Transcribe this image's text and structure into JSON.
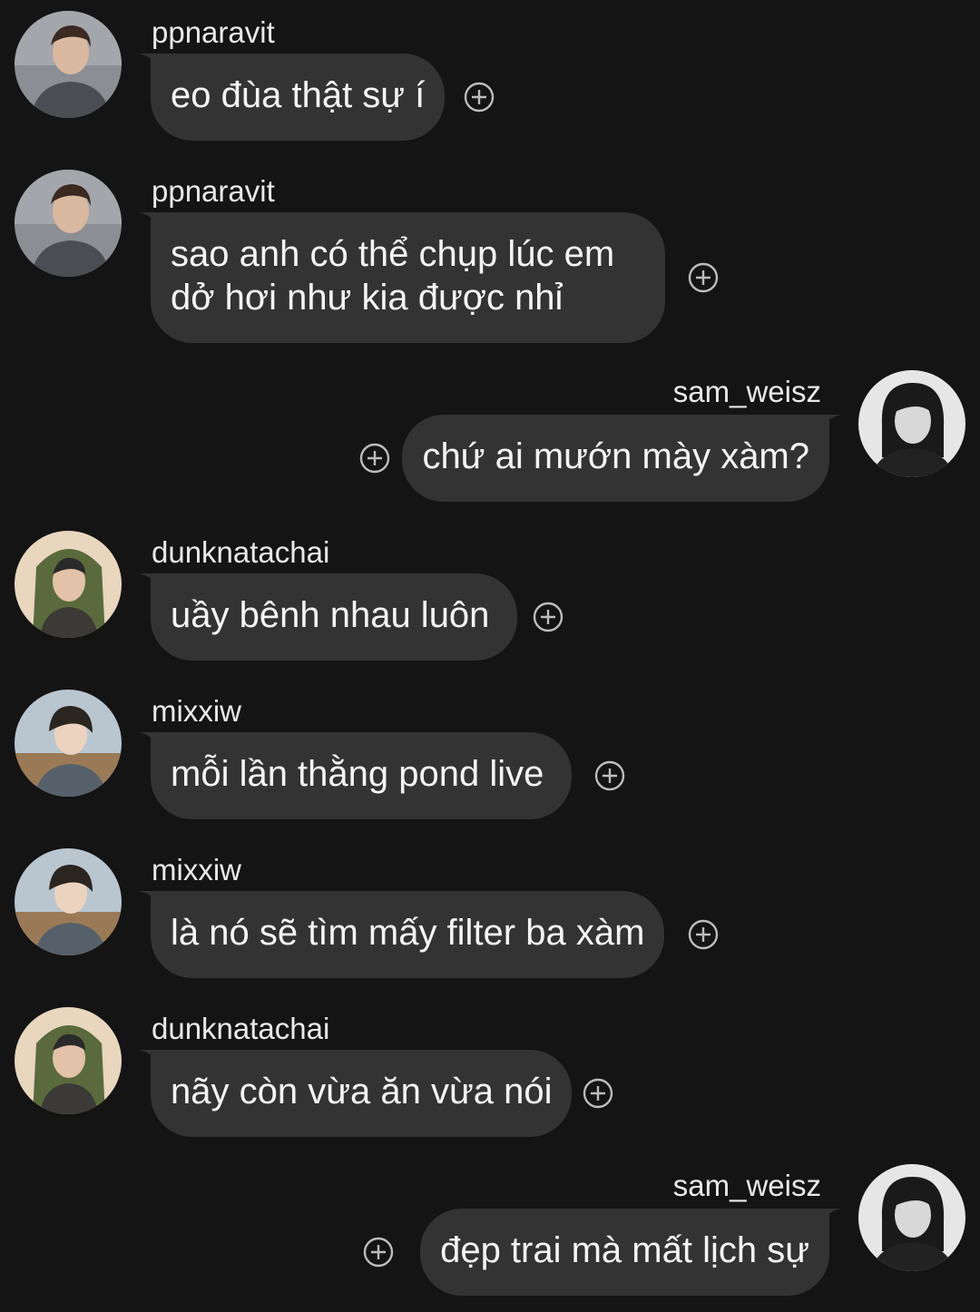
{
  "theme": {
    "background": "#141414",
    "bubble": "#333333",
    "text": "#f4f4f4"
  },
  "messages": [
    {
      "side": "incoming",
      "username": "ppnaravit",
      "text": "eo đùa thật sự í",
      "avatar": "user-avatar-icon",
      "react_icon": "add-reaction-icon"
    },
    {
      "side": "incoming",
      "username": "ppnaravit",
      "text": "sao anh có thể chụp lúc em\ndở hơi như kia được nhỉ",
      "avatar": "user-avatar-icon",
      "react_icon": "add-reaction-icon"
    },
    {
      "side": "outgoing",
      "username": "sam_weisz",
      "text": "chứ ai mướn mày xàm?",
      "avatar": "user-avatar-icon",
      "react_icon": "add-reaction-icon"
    },
    {
      "side": "incoming",
      "username": "dunknatachai",
      "text": "uầy bênh nhau luôn",
      "avatar": "user-avatar-icon",
      "react_icon": "add-reaction-icon"
    },
    {
      "side": "incoming",
      "username": "mixxiw",
      "text": "mỗi lần thằng pond live",
      "avatar": "user-avatar-icon",
      "react_icon": "add-reaction-icon"
    },
    {
      "side": "incoming",
      "username": "mixxiw",
      "text": "là nó sẽ tìm mấy filter ba xàm",
      "avatar": "user-avatar-icon",
      "react_icon": "add-reaction-icon"
    },
    {
      "side": "incoming",
      "username": "dunknatachai",
      "text": "nãy còn vừa ăn vừa nói",
      "avatar": "user-avatar-icon",
      "react_icon": "add-reaction-icon"
    },
    {
      "side": "outgoing",
      "username": "sam_weisz",
      "text": "đẹp trai mà mất lịch sự",
      "avatar": "user-avatar-icon",
      "react_icon": "add-reaction-icon"
    }
  ]
}
